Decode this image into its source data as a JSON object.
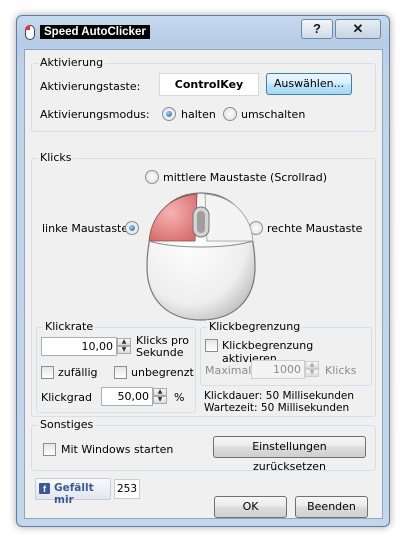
{
  "window": {
    "title": "Speed AutoClicker",
    "help_label": "?",
    "close_label": "✕"
  },
  "activation": {
    "group_title": "Aktivierung",
    "key_label": "Aktivierungstaste:",
    "key_value": "ControlKey",
    "select_button": "Auswählen...",
    "mode_label": "Aktivierungsmodus:",
    "mode_options": [
      "halten",
      "umschalten"
    ],
    "mode_selected": "halten"
  },
  "clicks": {
    "group_title": "Klicks",
    "middle_label": "mittlere Maustaste (Scrollrad)",
    "left_label": "linke Maustaste",
    "right_label": "rechte Maustaste",
    "selected": "linke Maustaste"
  },
  "click_rate": {
    "group_title": "Klickrate",
    "value": "10,00",
    "unit_line1": "Klicks pro",
    "unit_line2": "Sekunde",
    "random_label": "zufällig",
    "unlimited_label": "unbegrenzt",
    "degree_label": "Klickgrad",
    "degree_value": "50,00",
    "degree_unit": "%"
  },
  "click_limit": {
    "group_title": "Klickbegrenzung",
    "activate_label": "Klickbegrenzung aktivieren",
    "max_label": "Maximal",
    "max_value": "1000",
    "max_unit": "Klicks",
    "duration_text": "Klickdauer: 50 Millisekunden",
    "wait_text": "Wartezeit: 50 Millisekunden"
  },
  "other": {
    "group_title": "Sonstiges",
    "startup_label": "Mit Windows starten",
    "reset_button": "Einstellungen zurücksetzen"
  },
  "footer": {
    "like_label": "Gefällt mir",
    "like_count": "253",
    "ok_button": "OK",
    "quit_button": "Beenden"
  },
  "colors": {
    "mouse_highlight": "#e88a8a",
    "facebook": "#3b5998"
  }
}
